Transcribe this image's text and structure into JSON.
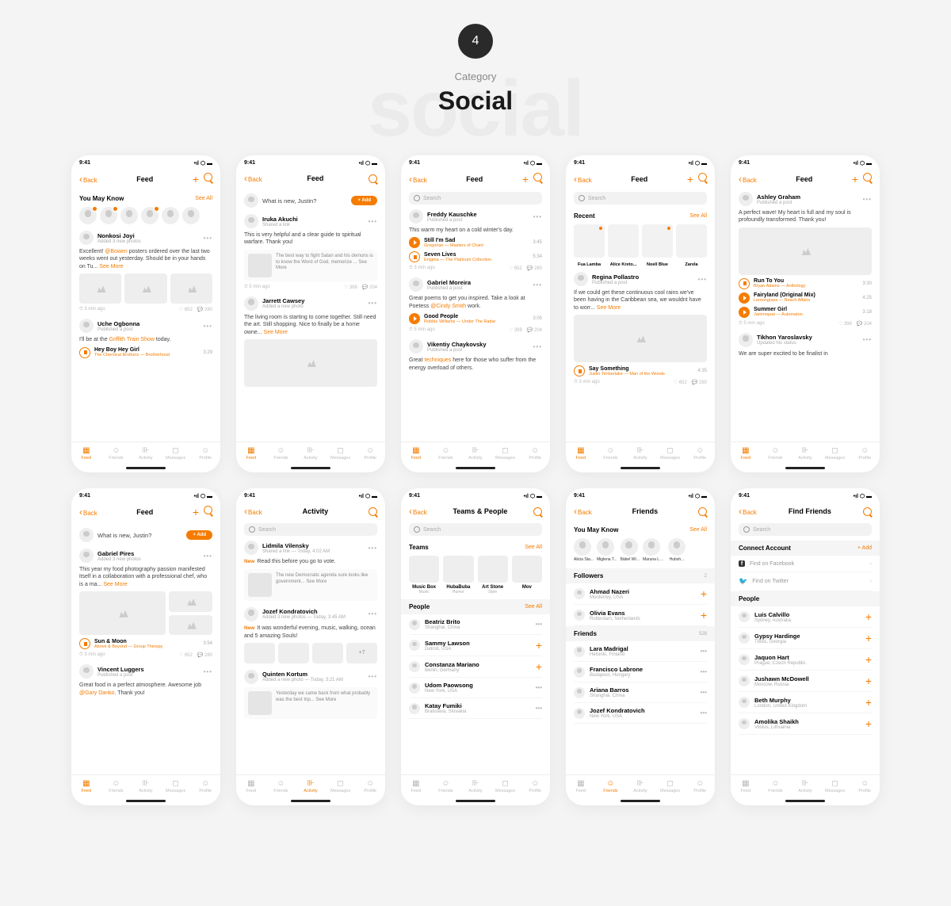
{
  "header": {
    "number": "4",
    "category": "Category",
    "title": "Social",
    "ghost": "social"
  },
  "common": {
    "time": "9:41",
    "back": "Back",
    "seeAll": "See All",
    "seeMore": "See More",
    "addBtn": "+ Add",
    "search": "Search",
    "tabs": [
      "Feed",
      "Friends",
      "Activity",
      "Messages",
      "Profile"
    ]
  },
  "s1": {
    "title": "Feed",
    "youMayKnow": "You May Know",
    "p1": {
      "name": "Nonkosi Joyi",
      "sub": "Added 3 new photos",
      "body": "Excellent! @Bowen posters ordered over the last two weeks went out yesterday. Should be in your hands on Tu...",
      "mention": "@Bowen",
      "footTime": "⏱ 3 min ago",
      "likes": "♡ 652",
      "comments": "💬 280"
    },
    "p2": {
      "name": "Uche Ogbonna",
      "sub": "Published a post",
      "body": "I'll be at the Griffith Train Show today.",
      "mention": "Griffith Train Show"
    },
    "track": {
      "name": "Hey Boy Hey Girl",
      "artist": "The Chemical Brothers — Brotherhood",
      "dur": "3:29"
    }
  },
  "s2": {
    "title": "Feed",
    "compose": "What is new, Justin?",
    "p1": {
      "name": "Iruka Akuchi",
      "sub": "Shared a link",
      "body": "This is very helpful and a clear guide to spiritual warfare. Thank you!",
      "quote": "The best way to fight Satan and his demons is to know the Word of God, memorize ...",
      "footTime": "⏱ 5 min ago",
      "likes": "♡ 398",
      "comments": "💬 204"
    },
    "p2": {
      "name": "Jarrett Cawsey",
      "sub": "Added a new photo",
      "body": "The living room is starting to come together. Still need the art. Still shopping. Nice to finally be a home owne..."
    }
  },
  "s3": {
    "title": "Feed",
    "p1": {
      "name": "Freddy Kauschke",
      "sub": "Published a post",
      "body": "This warm my heart on a cold winter's day."
    },
    "t1": {
      "name": "Still I'm Sad",
      "artist": "Gregorian — Masters of Chant",
      "dur": "3:45"
    },
    "t2": {
      "name": "Seven Lives",
      "artist": "Enigma — The Platinum Collection",
      "dur": "5:34"
    },
    "foot": {
      "time": "⏱ 3 min ago",
      "likes": "♡ 652",
      "comments": "💬 280"
    },
    "p2": {
      "name": "Gabriel Moreira",
      "sub": "Published a post",
      "body": "Great poems to get you inspired. Take a look at Poetess @Cindy Smith work.",
      "mention": "@Cindy Smith"
    },
    "t3": {
      "name": "Good People",
      "artist": "Robbie Williams — Under The Radar",
      "dur": "3:05"
    },
    "foot2": {
      "time": "⏱ 5 min ago",
      "likes": "♡ 398",
      "comments": "💬 204"
    },
    "p3": {
      "name": "Vikentiy Chaykovsky",
      "sub": "Published a post",
      "body": "Great techniques here for those who suffer from the energy overload of others.",
      "mention": "techniques"
    }
  },
  "s4": {
    "title": "Feed",
    "recent": "Recent",
    "names": [
      "Fua Lamba",
      "Alice Kreto...",
      "Noell Blue",
      "Zarela"
    ],
    "p1": {
      "name": "Regina Pollastro",
      "sub": "Published a post",
      "body": "If we could get these continuous cool rains we've been having in the Caribbean sea, we wouldnt have to worr..."
    },
    "track": {
      "name": "Say Something",
      "artist": "Justin Timberlake — Man of the Woods",
      "dur": "4:35"
    },
    "foot": {
      "time": "⏱ 3 min ago",
      "likes": "♡ 652",
      "comments": "💬 280"
    }
  },
  "s5": {
    "title": "Feed",
    "p1": {
      "name": "Ashley Graham",
      "sub": "Published a post",
      "body": "A perfect wave! My heart is full and my soul is profoundly transformed. Thank you!"
    },
    "t1": {
      "name": "Run To You",
      "artist": "Bryan Adams — Anthology",
      "dur": "3:30"
    },
    "t2": {
      "name": "Fairyland (Original Mix)",
      "artist": "Lemongrass — Beach Affairs",
      "dur": "4:25"
    },
    "t3": {
      "name": "Summer Girl",
      "artist": "Jamiroquai — Automaton",
      "dur": "3:18"
    },
    "foot": {
      "time": "⏱ 5 min ago",
      "likes": "♡ 398",
      "comments": "💬 204"
    },
    "p2": {
      "name": "Tikhon Yaroslavsky",
      "sub": "Updated his status",
      "body": "We are super excited to be finalist in"
    }
  },
  "s6": {
    "title": "Feed",
    "compose": "What is new, Justin?",
    "p1": {
      "name": "Gabriel Pires",
      "sub": "Added 3 new photos",
      "body": "This year my food photography passion manifested itself in a collaboration with a professional chef, who is a ma..."
    },
    "track": {
      "name": "Sun & Moon",
      "artist": "Above & Beyond — Group Therapy",
      "dur": "3:54"
    },
    "foot": {
      "time": "⏱ 3 min ago",
      "likes": "♡ 652",
      "comments": "💬 280"
    },
    "p2": {
      "name": "Vincent Luggers",
      "sub": "Published a post",
      "body": "Great food in a perfect atmosphere. Awesome job @Gary Danko. Thank you!",
      "mention": "@Gary Danko"
    }
  },
  "s7": {
    "title": "Activity",
    "p1": {
      "name": "Lidmila Vilensky",
      "sub": "Shared a link — Today, 4:02 AM",
      "body": "Read this before you go to vote.",
      "quote": "The new Democratic agenda sure looks like government..."
    },
    "p2": {
      "name": "Jozef Kondratovich",
      "sub": "Added 3 new photos — Today, 3:45 AM",
      "body": "It was wonderful evening, music, walking, ocean and 5 amazing Souls!",
      "extra": "+7"
    },
    "p3": {
      "name": "Quinten Kortum",
      "sub": "Added a new photo — Today, 3:21 AM",
      "quote": "Yesterday we came back from what probably was the best trip..."
    },
    "new": "New"
  },
  "s8": {
    "title": "Teams & People",
    "teams": "Teams",
    "people": "People",
    "teamList": [
      {
        "name": "Music Box",
        "type": "Music"
      },
      {
        "name": "HubaBuba",
        "type": "Humor"
      },
      {
        "name": "Art Stone",
        "type": "Style"
      },
      {
        "name": "Mov",
        "type": ""
      }
    ],
    "peopleList": [
      {
        "name": "Beatriz Brito",
        "loc": "Shanghai, China",
        "add": false
      },
      {
        "name": "Sammy Lawson",
        "loc": "Detroit, USA",
        "add": true
      },
      {
        "name": "Constanza Mariano",
        "loc": "Berlin, Germany",
        "add": true
      },
      {
        "name": "Udom Paowsong",
        "loc": "New York, USA",
        "add": false
      },
      {
        "name": "Katay Fumiki",
        "loc": "Bratislava, Slovakia",
        "add": false
      }
    ]
  },
  "s9": {
    "title": "Friends",
    "youMayKnow": "You May Know",
    "suggested": [
      "Alicia Sta...",
      "Miglena T...",
      "Bäbel WI...",
      "Maruna La...",
      "Hubsh..."
    ],
    "followers": "Followers",
    "followersCount": "2",
    "followersList": [
      {
        "name": "Ahmad Nazeri",
        "loc": "Monterrey, USA"
      },
      {
        "name": "Olivia Evans",
        "loc": "Rotterdam, Netherlands"
      }
    ],
    "friends": "Friends",
    "friendsCount": "528",
    "friendsList": [
      {
        "name": "Lara Madrigal",
        "loc": "Helsinki, Finland"
      },
      {
        "name": "Francisco Labrone",
        "loc": "Budapest, Hungary"
      },
      {
        "name": "Ariana Barros",
        "loc": "Shanghai, China"
      },
      {
        "name": "Jozef Kondratovich",
        "loc": "New York, USA"
      }
    ]
  },
  "s10": {
    "title": "Find Friends",
    "connect": "Connect Account",
    "fb": "Find on Facebook",
    "tw": "Find on Twitter",
    "people": "People",
    "peopleList": [
      {
        "name": "Luis Calvillo",
        "loc": "Sydney, Australia"
      },
      {
        "name": "Gypsy Hardinge",
        "loc": "Tbilisi, Georgia"
      },
      {
        "name": "Jaquon Hart",
        "loc": "Prague, Czech Republic"
      },
      {
        "name": "Jushawn McDowell",
        "loc": "Moscow, Russia"
      },
      {
        "name": "Beth Murphy",
        "loc": "London, United Kingdom"
      },
      {
        "name": "Amolika Shaikh",
        "loc": "Vilnius, Lithuania"
      }
    ]
  }
}
